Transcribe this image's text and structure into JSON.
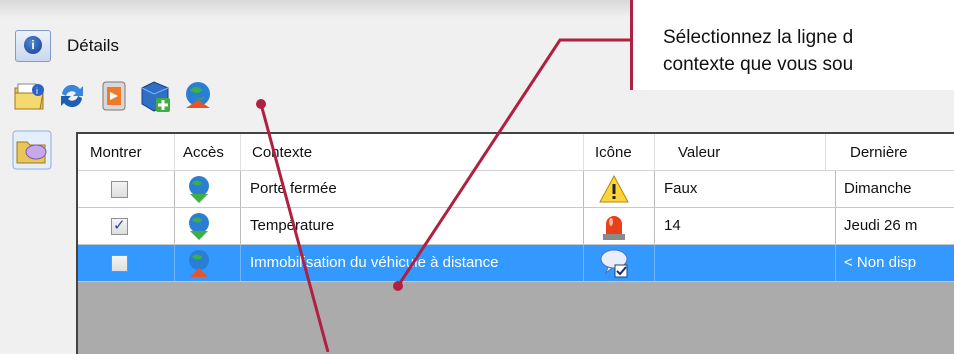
{
  "window": {
    "title": "Détails"
  },
  "toolbar": {
    "icons": [
      "folder-info-icon",
      "refresh-icon",
      "export-icon",
      "add-cube-icon",
      "globe-context-icon"
    ]
  },
  "grid": {
    "columns": [
      "Montrer",
      "Accès",
      "Contexte",
      "Icône",
      "Valeur",
      "Dernière"
    ],
    "rows": [
      {
        "checked": false,
        "context": "Porte fermée",
        "icon": "warning-icon",
        "value": "Faux",
        "last": "Dimanche",
        "access": "globe-down-green-icon"
      },
      {
        "checked": true,
        "context": "Température",
        "icon": "alarm-light-icon",
        "value": "14",
        "last": "Jeudi 26 m",
        "access": "globe-down-green-icon"
      },
      {
        "checked": false,
        "context": "Immobilisation du véhicule à distance",
        "icon": "message-check-icon",
        "value": "",
        "last": "< Non disp",
        "access": "globe-up-red-icon",
        "selected": true
      }
    ]
  },
  "callout": {
    "text": "Sélectionnez la ligne d\ncontexte que vous sou"
  },
  "colors": {
    "selection": "#3399ff",
    "callout_border": "#b02040",
    "annotation_line": "#b02040"
  }
}
